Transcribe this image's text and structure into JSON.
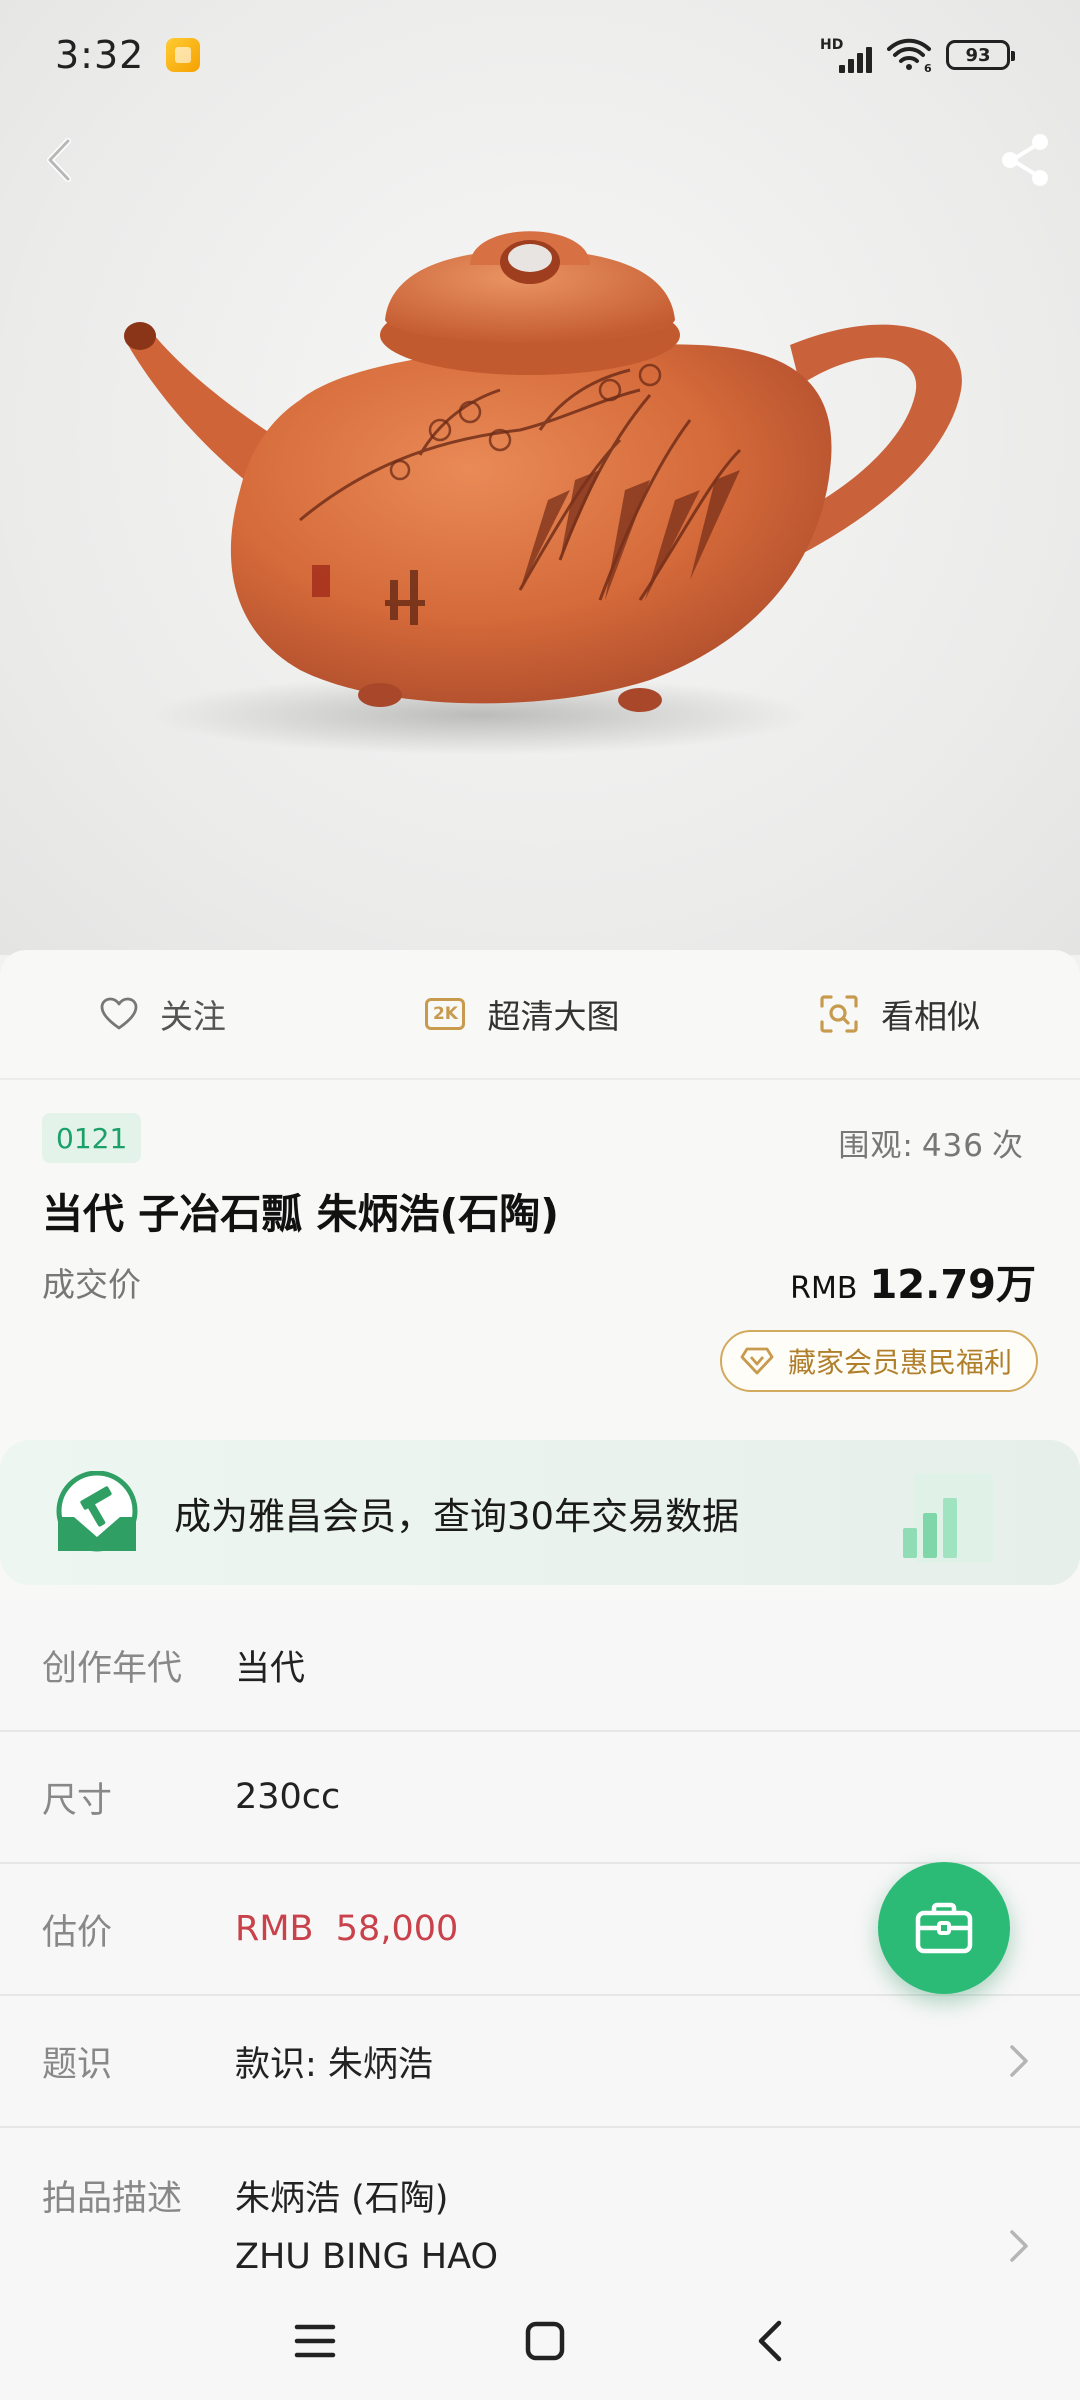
{
  "status_bar": {
    "time": "3:32",
    "hd_label": "HD",
    "wifi_sub": "6",
    "battery": "93"
  },
  "hero": {
    "image_alt": "teapot-photo"
  },
  "actions": {
    "follow_label": "关注",
    "hd_chip": "2K",
    "hd_label": "超清大图",
    "similar_label": "看相似"
  },
  "lot": {
    "number": "0121",
    "views_prefix": "围观:",
    "views_count": "436",
    "views_suffix": "次",
    "title": "当代 子冶石瓢 朱炳浩(石陶)",
    "price_label": "成交价",
    "price_currency": "RMB",
    "price_amount": "12.79万",
    "member_pill": "藏家会员惠民福利"
  },
  "promo": {
    "text": "成为雅昌会员，查询30年交易数据"
  },
  "details": [
    {
      "label": "创作年代",
      "value": "当代"
    },
    {
      "label": "尺寸",
      "value": "230cc"
    },
    {
      "label": "估价",
      "value": "RMB  58,000"
    },
    {
      "label": "题识",
      "value": "款识: 朱炳浩"
    },
    {
      "label": "拍品描述",
      "value": "朱炳浩 (石陶)",
      "value2": "ZHU BING HAO"
    }
  ],
  "colors": {
    "accent_green": "#2bbb76",
    "gold": "#c79a4e",
    "estimate_red": "#c9414a"
  }
}
